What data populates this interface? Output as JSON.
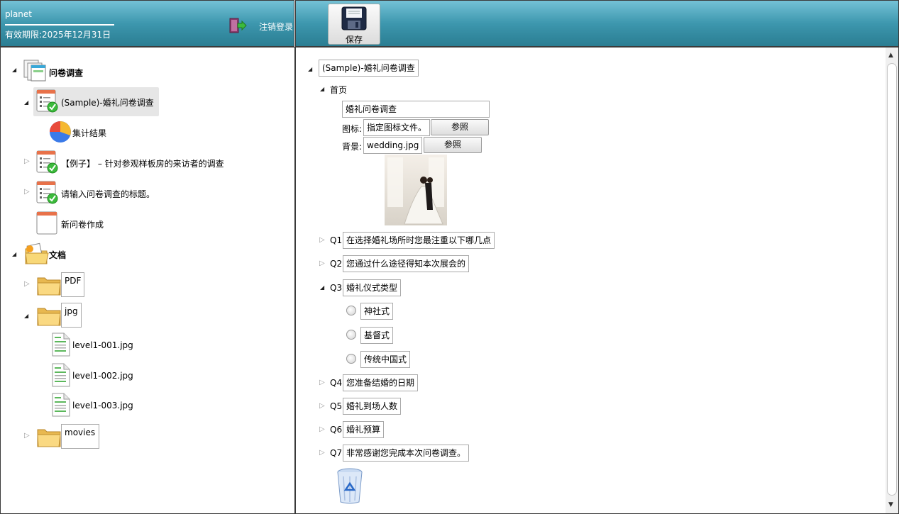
{
  "header": {
    "user": "planet",
    "expiry": "有效期限:2025年12月31日",
    "logout_label": "注销登录",
    "save_label": "保存"
  },
  "left_tree": {
    "survey_root": "问卷调查",
    "survey_item1": "(Sample)-婚礼问卷调查",
    "survey_item1_child": "集计结果",
    "survey_item2": "【例子】 – 针对参观样板房的来访者的调查",
    "survey_item3": "请输入问卷调查的标题。",
    "survey_new": "新问卷作成",
    "docs_root": "文档",
    "folder_pdf": "PDF",
    "folder_jpg": "jpg",
    "jpg_files": [
      "level1-001.jpg",
      "level1-002.jpg",
      "level1-003.jpg"
    ],
    "folder_movies": "movies"
  },
  "editor": {
    "survey_title": "(Sample)-婚礼问卷调查",
    "home_label": "首页",
    "home_title": "婚礼问卷调查",
    "icon_label": "图标:",
    "icon_value": "指定图标文件。",
    "icon_browse": "参照",
    "bg_label": "背景:",
    "bg_value": "wedding.jpg",
    "bg_browse": "参照",
    "questions": [
      {
        "num": "Q1",
        "text": "在选择婚礼场所时您最注重以下哪几点"
      },
      {
        "num": "Q2",
        "text": "您通过什么途径得知本次展会的"
      },
      {
        "num": "Q3",
        "text": "婚礼仪式类型"
      },
      {
        "num": "Q4",
        "text": "您准备结婚的日期"
      },
      {
        "num": "Q5",
        "text": "婚礼到场人数"
      },
      {
        "num": "Q6",
        "text": "婚礼预算"
      },
      {
        "num": "Q7",
        "text": "非常感谢您完成本次问卷调查。"
      }
    ],
    "q3_options": [
      "神社式",
      "基督式",
      "传统中国式"
    ]
  }
}
